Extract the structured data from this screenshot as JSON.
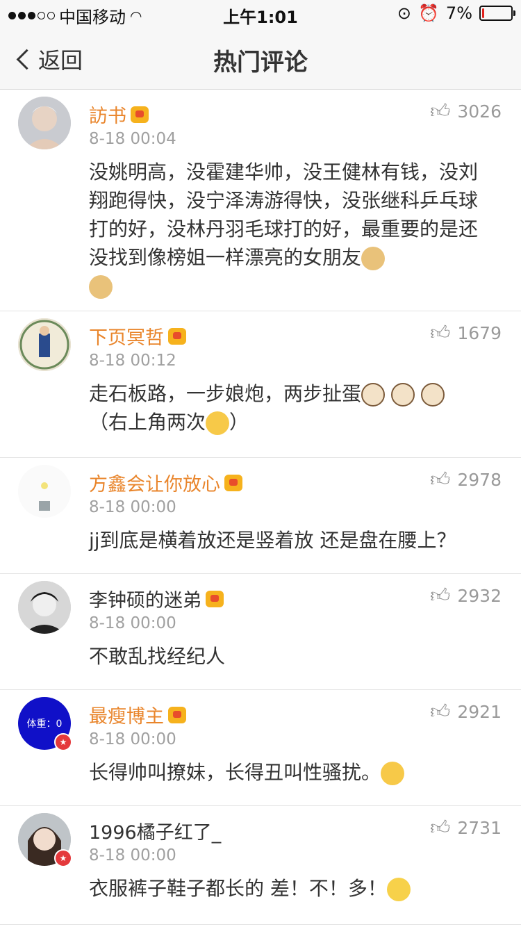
{
  "status_bar": {
    "carrier": "中国移动",
    "time": "上午1:01",
    "battery": "7%",
    "battery_level": 0.07,
    "icons": [
      "signal-dots-icon",
      "wifi-icon",
      "lock-rotation-icon",
      "alarm-icon",
      "battery-icon"
    ]
  },
  "nav": {
    "back_label": "返回",
    "title": "热门评论"
  },
  "comments": [
    {
      "username": "訪书",
      "time": "8-18 00:04",
      "likes": "3026",
      "text": "没姚明高，没霍建华帅，没王健林有钱，没刘翔跑得快，没宁泽涛游得快，没张继科乒乓球打的好，没林丹羽毛球打的好，最重要的是还没找到像榜姐一样漂亮的女朋友",
      "emojis": [
        "doge-emoji",
        "doge-emoji"
      ]
    },
    {
      "username": "下页冥哲",
      "time": "8-18 00:12",
      "likes": "1679",
      "text": "走石板路，一步娘炮，两步扯蛋",
      "text2": "（右上角两次",
      "text3": "）",
      "emojis": [
        "cat-emoji",
        "cat-emoji",
        "cat-emoji",
        "thinking-emoji"
      ]
    },
    {
      "username": "方鑫会让你放心",
      "time": "8-18 00:00",
      "likes": "2978",
      "text": "jj到底是横着放还是竖着放 还是盘在腰上？"
    },
    {
      "username": "李钟硕的迷弟",
      "time": "8-18 00:00",
      "likes": "2932",
      "text": "不敢乱找经纪人"
    },
    {
      "username": "最瘦博主",
      "time": "8-18 00:00",
      "likes": "2921",
      "text": "长得帅叫撩妹，长得丑叫性骚扰。",
      "avatar_text": "体重：0",
      "emojis": [
        "thinking-emoji"
      ]
    },
    {
      "username": "1996橘子红了_",
      "time": "8-18 00:00",
      "likes": "2731",
      "text": "衣服裤子鞋子都长的 差！不！多！",
      "emojis": [
        "laugh-cry-emoji"
      ]
    }
  ],
  "colors": {
    "vip_name": "#e9852b",
    "bar_bg": "#f7f7f7",
    "timestamp": "#a0a0a0",
    "battery_low": "#e0211c"
  }
}
